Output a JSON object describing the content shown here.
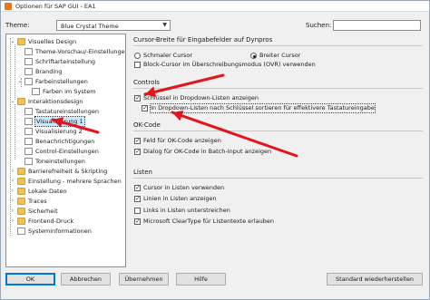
{
  "window": {
    "title": "Optionen für SAP GUI - EA1"
  },
  "header": {
    "theme_label": "Theme:",
    "theme_value": "Blue Crystal Theme",
    "search_label": "Suchen:",
    "search_value": ""
  },
  "tree": {
    "items": [
      {
        "label": "Visuelles Design",
        "level": 0,
        "type": "folder",
        "state": "expanded"
      },
      {
        "label": "Theme-Vorschau/-Einstellungen",
        "level": 1,
        "type": "page"
      },
      {
        "label": "Schriftarteinstellung",
        "level": 1,
        "type": "page"
      },
      {
        "label": "Branding",
        "level": 1,
        "type": "page"
      },
      {
        "label": "Farbeinstellungen",
        "level": 1,
        "type": "page",
        "state": "expanded"
      },
      {
        "label": "Farben im System",
        "level": 2,
        "type": "page"
      },
      {
        "label": "Interaktionsdesign",
        "level": 0,
        "type": "folder",
        "state": "expanded"
      },
      {
        "label": "Tastatureinstellungen",
        "level": 1,
        "type": "page"
      },
      {
        "label": "Visualisierung 1",
        "level": 1,
        "type": "page",
        "selected": true
      },
      {
        "label": "Visualisierung 2",
        "level": 1,
        "type": "page"
      },
      {
        "label": "Benachrichtigungen",
        "level": 1,
        "type": "page"
      },
      {
        "label": "Control-Einstellungen",
        "level": 1,
        "type": "page"
      },
      {
        "label": "Toneinstellungen",
        "level": 1,
        "type": "page"
      },
      {
        "label": "Barrierefreiheit & Skripting",
        "level": 0,
        "type": "folder",
        "state": "collapsed"
      },
      {
        "label": "Einstellung - mehrere Sprachen",
        "level": 0,
        "type": "folder",
        "state": "collapsed"
      },
      {
        "label": "Lokale Daten",
        "level": 0,
        "type": "folder",
        "state": "collapsed"
      },
      {
        "label": "Traces",
        "level": 0,
        "type": "folder",
        "state": "collapsed"
      },
      {
        "label": "Sicherheit",
        "level": 0,
        "type": "folder",
        "state": "collapsed"
      },
      {
        "label": "Frontend-Druck",
        "level": 0,
        "type": "folder",
        "state": "collapsed"
      },
      {
        "label": "Systeminformationen",
        "level": 0,
        "type": "page"
      }
    ]
  },
  "sections": {
    "cursor": {
      "title": "Cursor-Breite für Eingabefelder auf Dynpros",
      "schmal": "Schmaler Cursor",
      "schmal_checked": false,
      "breit": "Breiter Cursor",
      "breit_checked": true,
      "block": "Block-Cursor im Überschreibungsmodus (OVR) verwenden",
      "block_checked": false
    },
    "controls": {
      "title": "Controls",
      "key_in_dropdown": "Schlüssel in Dropdown-Listen anzeigen",
      "key_in_dropdown_checked": true,
      "sort_by_key": "In Dropdown-Listen nach Schlüssel sortieren für effektivere Tastatureingabe",
      "sort_by_key_checked": true
    },
    "okcode": {
      "title": "OK-Code",
      "field": "Feld für OK-Code anzeigen",
      "field_checked": true,
      "dialog": "Dialog für OK-Code in Batch-Input anzeigen",
      "dialog_checked": true
    },
    "lists": {
      "title": "Listen",
      "cursor": "Cursor in Listen verwenden",
      "cursor_checked": true,
      "lines": "Linien in Listen anzeigen",
      "lines_checked": true,
      "links": "Links in Listen unterstreichen",
      "links_checked": false,
      "cleartype": "Microsoft ClearType für Listentexte erlauben",
      "cleartype_checked": true
    }
  },
  "buttons": {
    "ok": "OK",
    "cancel": "Abbrechen",
    "apply": "Übernehmen",
    "help": "Hilfe",
    "restore": "Standard wiederherstellen"
  },
  "colors": {
    "arrow": "#e3141b",
    "selection": "#cce8ff",
    "focus_button": "#0078d7"
  }
}
